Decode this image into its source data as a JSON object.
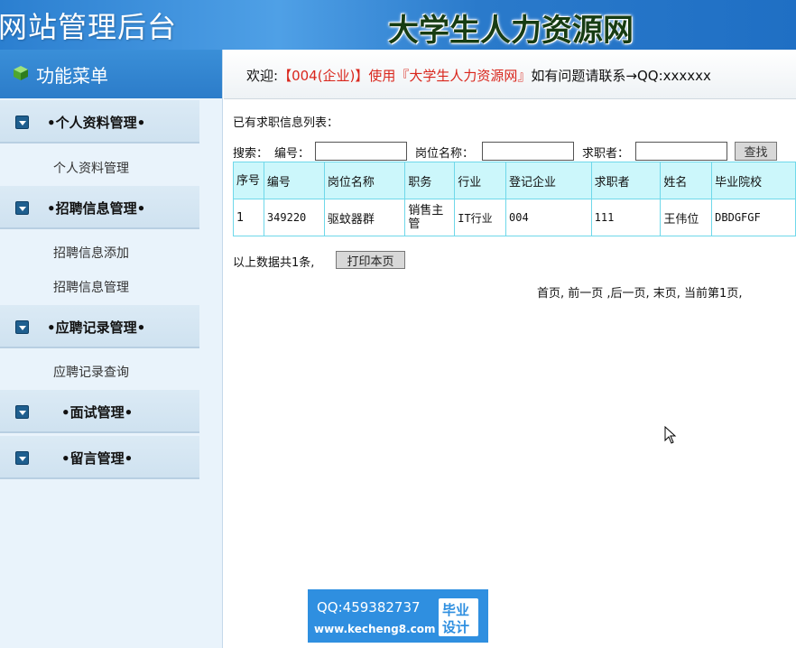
{
  "header": {
    "admin_title": "网站管理后台",
    "site_title": "大学生人力资源网"
  },
  "sidebar": {
    "menu_title": "功能菜单",
    "groups": [
      {
        "label": "•个人资料管理•",
        "items": [
          "个人资料管理"
        ]
      },
      {
        "label": "•招聘信息管理•",
        "items": [
          "招聘信息添加",
          "招聘信息管理"
        ]
      },
      {
        "label": "•应聘记录管理•",
        "items": [
          "应聘记录查询"
        ]
      },
      {
        "label": "•面试管理•",
        "items": []
      },
      {
        "label": "•留言管理•",
        "items": []
      }
    ]
  },
  "welcome": {
    "prefix": "欢迎:",
    "highlight": "【004(企业)】使用『大学生人力资源网』",
    "suffix": "如有问题请联系→QQ:xxxxxx"
  },
  "list_caption": "已有求职信息列表：",
  "search": {
    "label_prefix": "搜索：",
    "field1_label": "编号：",
    "field2_label": "岗位名称：",
    "field3_label": "求职者：",
    "field1_value": "",
    "field2_value": "",
    "field3_value": "",
    "button_label": "查找"
  },
  "table": {
    "headers": [
      "序号",
      "编号",
      "岗位名称",
      "职务",
      "行业",
      "登记企业",
      "求职者",
      "姓名",
      "毕业院校"
    ],
    "rows": [
      [
        "1",
        "349220",
        "驱蚊器群",
        "销售主管",
        "IT行业",
        "004",
        "111",
        "王伟位",
        "DBDGFGF"
      ]
    ]
  },
  "footer": {
    "total_text": "以上数据共1条,",
    "print_label": "打印本页",
    "pager_text": "首页,  前一页 ,后一页,  末页,  当前第1页,"
  },
  "watermark": {
    "qq": "QQ:459382737",
    "url": "www.kecheng8.com",
    "badge_line1": "毕业",
    "badge_line2": "设计"
  },
  "colors": {
    "header_blue": "#2b7fd0",
    "sidebar_bg": "#e9f3fb",
    "highlight_red": "#d9261c",
    "table_border": "#6fd8ea",
    "table_head_bg": "#ccf7fb"
  }
}
